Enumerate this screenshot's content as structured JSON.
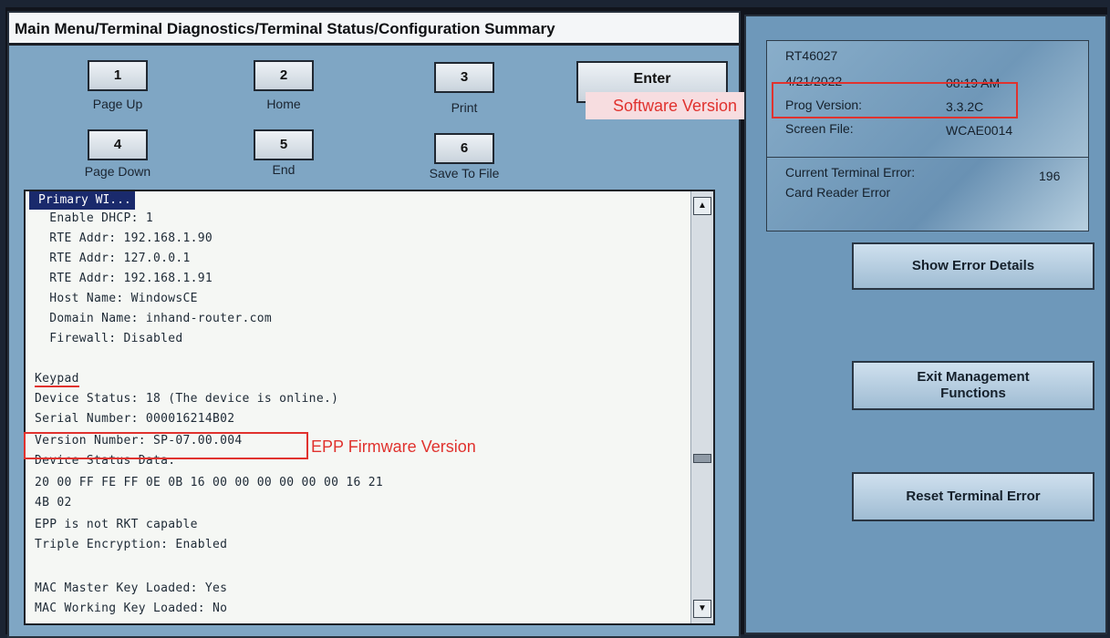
{
  "title": "Main Menu/Terminal Diagnostics/Terminal Status/Configuration Summary",
  "keypad": [
    {
      "key": "1",
      "label": "Page Up"
    },
    {
      "key": "2",
      "label": "Home"
    },
    {
      "key": "3",
      "label": "Print"
    },
    {
      "key": "4",
      "label": "Page Down"
    },
    {
      "key": "5",
      "label": "End"
    },
    {
      "key": "6",
      "label": "Save To File"
    }
  ],
  "enter_label": "Enter",
  "log": {
    "selected": "Primary WI...",
    "lines": [
      "  Enable DHCP: 1",
      "  RTE Addr: 192.168.1.90",
      "  RTE Addr: 127.0.0.1",
      "  RTE Addr: 192.168.1.91",
      "  Host Name: WindowsCE",
      "  Domain Name: inhand-router.com",
      "  Firewall: Disabled",
      "",
      "Keypad",
      "Device Status: 18 (The device is online.)",
      "Serial Number: 000016214B02",
      "Version Number: SP-07.00.004",
      "Device Status Data:",
      "20 00 FF FE FF 0E 0B 16 00 00 00 00 00 00 16 21",
      "4B 02",
      "EPP is not RKT capable",
      "Triple Encryption: Enabled",
      "",
      "MAC Master Key Loaded: Yes",
      "MAC Working Key Loaded: No"
    ]
  },
  "annotations": {
    "software": "Software Version",
    "epp": "EPP Firmware Version",
    "color": "#e0322e"
  },
  "terminal": {
    "id": "RT46027",
    "date": "4/21/2022",
    "time": "08:19 AM",
    "prog_label": "Prog Version:",
    "prog_value": "3.3.2C",
    "screen_label": "Screen File:",
    "screen_value": "WCAE0014"
  },
  "error": {
    "label": "Current Terminal Error:",
    "code": "196",
    "text": "Card Reader Error"
  },
  "buttons": {
    "show_error": "Show Error Details",
    "exit_mgmt": "Exit Management Functions",
    "reset_error": "Reset Terminal Error"
  },
  "icons": {
    "scroll_up": "scroll-up-arrow-icon",
    "scroll_down": "scroll-down-arrow-icon"
  }
}
